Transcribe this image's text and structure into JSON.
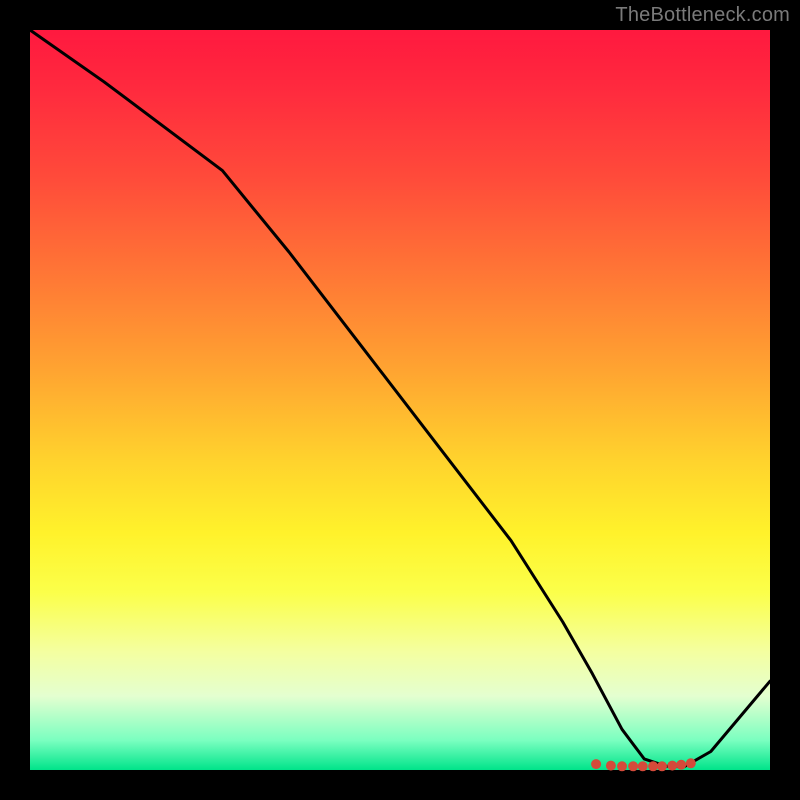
{
  "attribution": "TheBottleneck.com",
  "chart_data": {
    "type": "line",
    "title": "",
    "xlabel": "",
    "ylabel": "",
    "xlim": [
      0,
      100
    ],
    "ylim": [
      0,
      100
    ],
    "x": [
      0,
      10,
      26,
      35,
      45,
      55,
      65,
      72,
      76,
      80,
      83,
      86,
      88.5,
      92,
      100
    ],
    "values": [
      100,
      93,
      81,
      70,
      57,
      44,
      31,
      20,
      13,
      5.5,
      1.5,
      0.5,
      0.5,
      2.5,
      12
    ],
    "markers": {
      "x": [
        76.5,
        78.5,
        80.0,
        81.5,
        82.8,
        84.2,
        85.4,
        86.8,
        88.0,
        89.3
      ],
      "y": [
        0.8,
        0.6,
        0.5,
        0.5,
        0.5,
        0.5,
        0.5,
        0.6,
        0.7,
        0.9
      ]
    },
    "gradient_stops": [
      {
        "pct": 0,
        "color": "#ff193f"
      },
      {
        "pct": 20,
        "color": "#ff4b3a"
      },
      {
        "pct": 46,
        "color": "#ffa431"
      },
      {
        "pct": 68,
        "color": "#fff22b"
      },
      {
        "pct": 90,
        "color": "#e4ffd0"
      },
      {
        "pct": 100,
        "color": "#00e48a"
      }
    ]
  }
}
